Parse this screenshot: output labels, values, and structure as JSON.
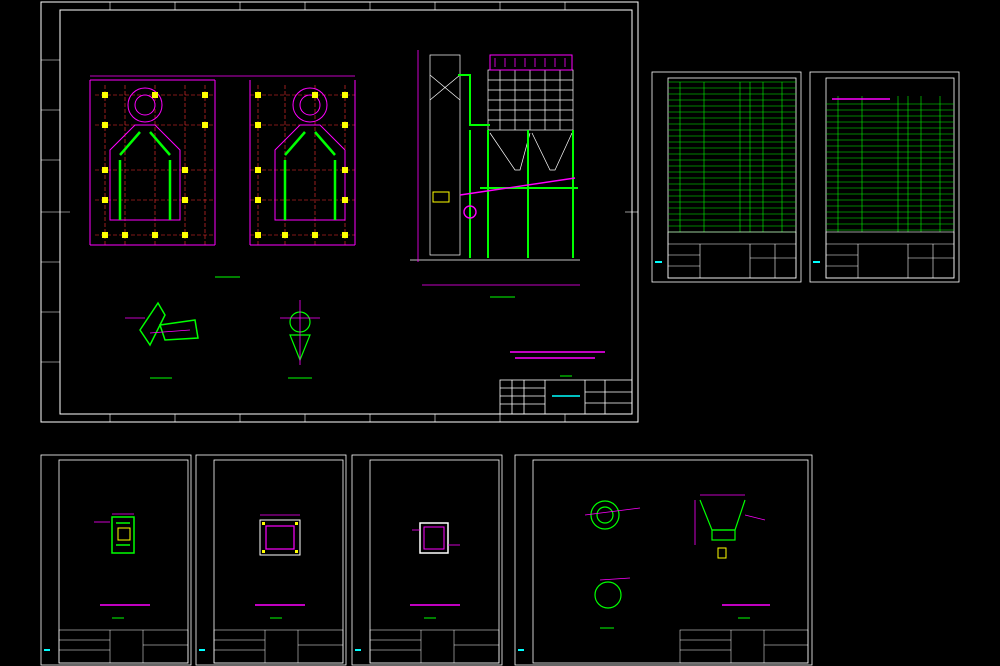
{
  "colors": {
    "background": "#000000",
    "frame": "#ffffff",
    "structure": "#ff00ff",
    "member": "#00ff00",
    "column": "#ffff00",
    "grid_line": "#ff3333",
    "table_line": "#00ff00",
    "label": "#00ffff"
  },
  "sheets": [
    {
      "id": "main",
      "kind": "general-arrangement"
    },
    {
      "id": "table-1",
      "kind": "material-list"
    },
    {
      "id": "table-2",
      "kind": "material-list"
    },
    {
      "id": "detail-1",
      "kind": "detail"
    },
    {
      "id": "detail-2",
      "kind": "detail"
    },
    {
      "id": "detail-3",
      "kind": "detail"
    },
    {
      "id": "detail-4",
      "kind": "detail"
    }
  ]
}
